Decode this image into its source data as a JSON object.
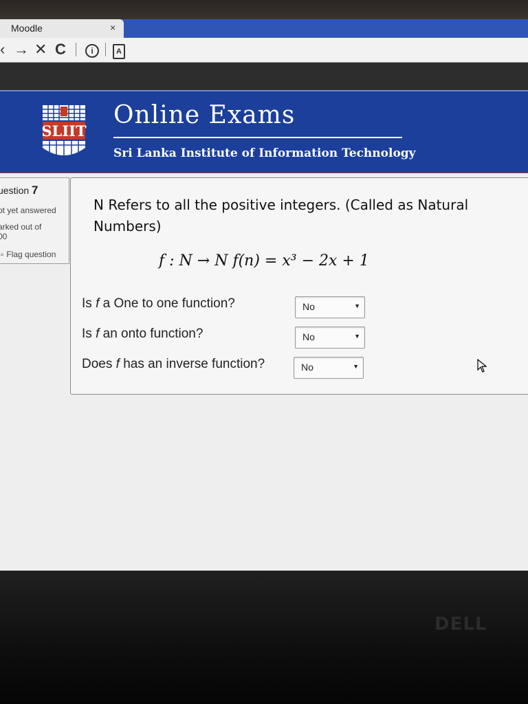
{
  "browser": {
    "tab_title": "Moodle",
    "tab_close": "×",
    "back": "‹",
    "forward": "→",
    "stop": "✕",
    "reload": "C",
    "info": "i",
    "page_icon": "A"
  },
  "header": {
    "logo_text": "SLIIT",
    "title": "Online Exams",
    "subtitle": "Sri Lanka Institute of Information Technology"
  },
  "question_info": {
    "number_label": "uestion",
    "number": "7",
    "state": "ot yet answered",
    "marked": "arked out of",
    "marks": "00",
    "flag_label": "Flag question"
  },
  "question": {
    "text": "N Refers to all the positive integers. (Called as Natural Numbers)",
    "formula": "f : N → N   f(n) = x³ − 2x + 1",
    "subquestions": [
      {
        "prefix": "Is ",
        "var": "f",
        "suffix": " a One to one function?",
        "selected": "No"
      },
      {
        "prefix": "Is ",
        "var": "f",
        "suffix": " an onto function?",
        "selected": "No"
      },
      {
        "prefix": "Does ",
        "var": "f",
        "suffix": " has an inverse function?",
        "selected": "No"
      }
    ]
  },
  "brand": "DELL",
  "colors": {
    "banner": "#1b3f9a",
    "banner_accent": "#c23a2a",
    "tab_strip": "#2f55b6"
  }
}
